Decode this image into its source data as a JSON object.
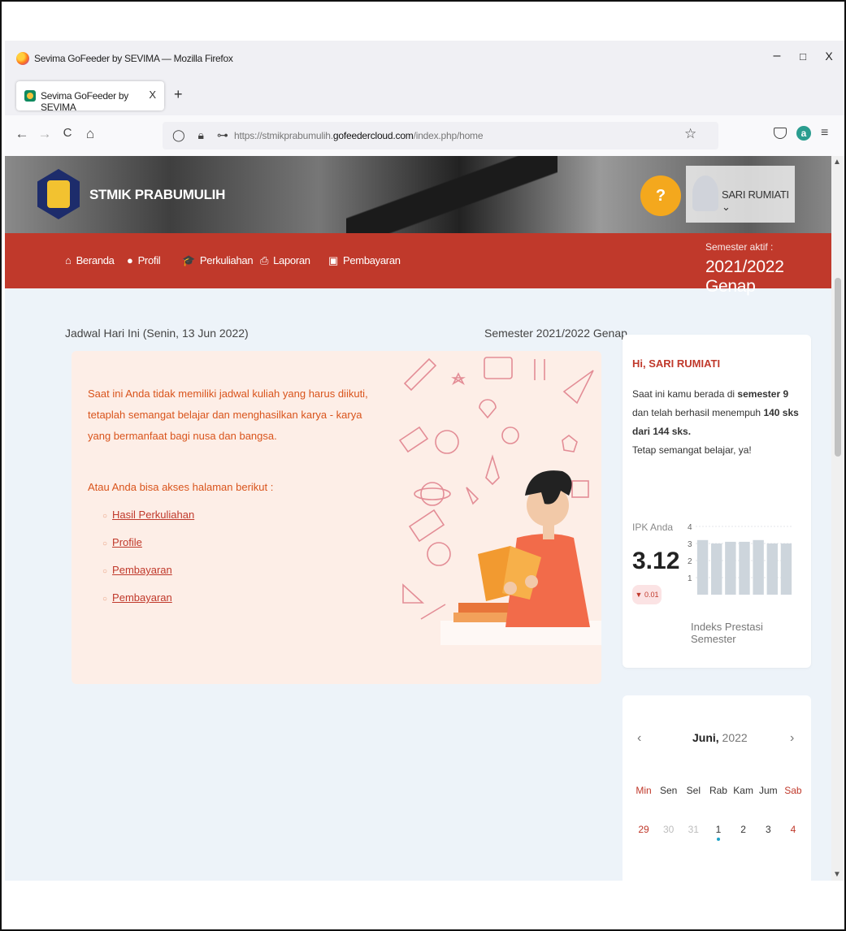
{
  "window": {
    "title": "Sevima GoFeeder by SEVIMA — Mozilla Firefox",
    "controls": {
      "minimize": "–",
      "maximize": "□",
      "close": "X"
    }
  },
  "tabs": [
    {
      "label": "Sevima GoFeeder by SEVIMA",
      "close": "X"
    }
  ],
  "new_tab": "+",
  "nav": {
    "back": "←",
    "forward": "→",
    "reload": "C",
    "home": "⌂",
    "url_prefix": "https://stmikprabumulih.",
    "url_domain": "gofeedercloud.com",
    "url_path": "/index.php/home",
    "extension_label": "a"
  },
  "site": {
    "name": "STMIK PRABUMULIH",
    "user_name": "SARI RUMIATI ⌄",
    "help_badge": "?"
  },
  "menu": [
    {
      "icon": "⌂",
      "label": "Beranda"
    },
    {
      "icon": "●",
      "label": "Profil"
    },
    {
      "icon": "🎓",
      "label": "Perkuliahan"
    },
    {
      "icon": "⎙",
      "label": "Laporan"
    },
    {
      "icon": "▣",
      "label": "Pembayaran"
    }
  ],
  "semester": {
    "label": "Semester aktif :",
    "value": "2021/2022 Genap"
  },
  "schedule": {
    "title": "Jadwal Hari Ini (Senin, 13 Jun 2022)",
    "semester": "Semester 2021/2022 Genap",
    "message": "Saat ini Anda tidak memiliki jadwal kuliah yang harus diikuti, tetaplah semangat belajar dan menghasilkan karya - karya yang bermanfaat bagi nusa dan bangsa.",
    "access_label": "Atau Anda bisa akses halaman berikut :",
    "links": [
      "Hasil Perkuliahan",
      "Profile",
      "Pembayaran",
      "Pembayaran"
    ]
  },
  "summary": {
    "greeting": "Hi, SARI RUMIATI",
    "line1": "Saat ini kamu berada di ",
    "semester_text": "semester 9",
    "line2": " dan telah berhasil menempuh ",
    "sks_text": "140 sks dari 144 sks.",
    "line3": "Tetap semangat belajar, ya!",
    "ipk_label": "IPK Anda",
    "ipk_value": "3.12",
    "ipk_delta": "▼ 0.01",
    "chart_caption": "Indeks Prestasi Semester"
  },
  "chart_data": {
    "type": "bar",
    "title": "",
    "ylim": [
      0,
      4
    ],
    "y_ticks": [
      "4",
      "3",
      "2",
      "1"
    ],
    "values": [
      3.2,
      3.0,
      3.1,
      3.1,
      3.2,
      3.0,
      3.0
    ],
    "grid": true,
    "bar_color": "#cdd5dc"
  },
  "calendar": {
    "prev": "‹",
    "next": "›",
    "month": "Juni,",
    "year": " 2022",
    "weekdays": [
      "Min",
      "Sen",
      "Sel",
      "Rab",
      "Kam",
      "Jum",
      "Sab"
    ],
    "days": [
      "29",
      "30",
      "31",
      "1",
      "2",
      "3",
      "4"
    ]
  },
  "colors": {
    "primary_red": "#c0392b",
    "accent_orange": "#d9541c",
    "help_yellow": "#f4a81d",
    "page_bg": "#edf3f9"
  }
}
